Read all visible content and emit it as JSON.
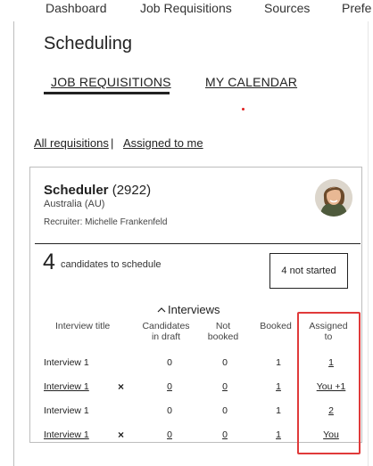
{
  "topnav": {
    "items": [
      "Dashboard",
      "Job Requisitions",
      "Sources",
      "Prefe"
    ]
  },
  "page": {
    "title": "Scheduling"
  },
  "tabs": [
    "JOB REQUISITIONS",
    "MY CALENDAR"
  ],
  "filters": {
    "all": "All requisitions",
    "separator": "|",
    "assigned": "Assigned to me"
  },
  "requisition": {
    "title": "Scheduler",
    "id": "(2922)",
    "location": "Australia (AU)",
    "recruiter": "Recruiter: Michelle Frankenfeld",
    "count": "4",
    "count_label": "candidates to schedule",
    "status": "4 not started"
  },
  "interviews": {
    "header": "Interviews",
    "columns": {
      "title": "Interview title",
      "draft_line1": "Candidates",
      "draft_line2": "in draft",
      "not_booked_line1": "Not",
      "not_booked_line2": "booked",
      "booked": "Booked",
      "assigned_line1": "Assigned",
      "assigned_line2": "to"
    },
    "rows": [
      {
        "title": "Interview 1",
        "draft": "0",
        "not_booked": "0",
        "booked": "1",
        "assigned": "1"
      },
      {
        "title": "Interview 1",
        "draft": "0",
        "not_booked": "0",
        "booked": "1",
        "assigned": "You +1",
        "remove": "×"
      },
      {
        "title": "Interview 1",
        "draft": "0",
        "not_booked": "0",
        "booked": "1",
        "assigned": "2"
      },
      {
        "title": "Interview 1",
        "draft": "0",
        "not_booked": "0",
        "booked": "1",
        "assigned": "You",
        "remove": "×"
      }
    ]
  },
  "colors": {
    "highlight": "#e03a3a",
    "accent_dot": "#e02020"
  }
}
